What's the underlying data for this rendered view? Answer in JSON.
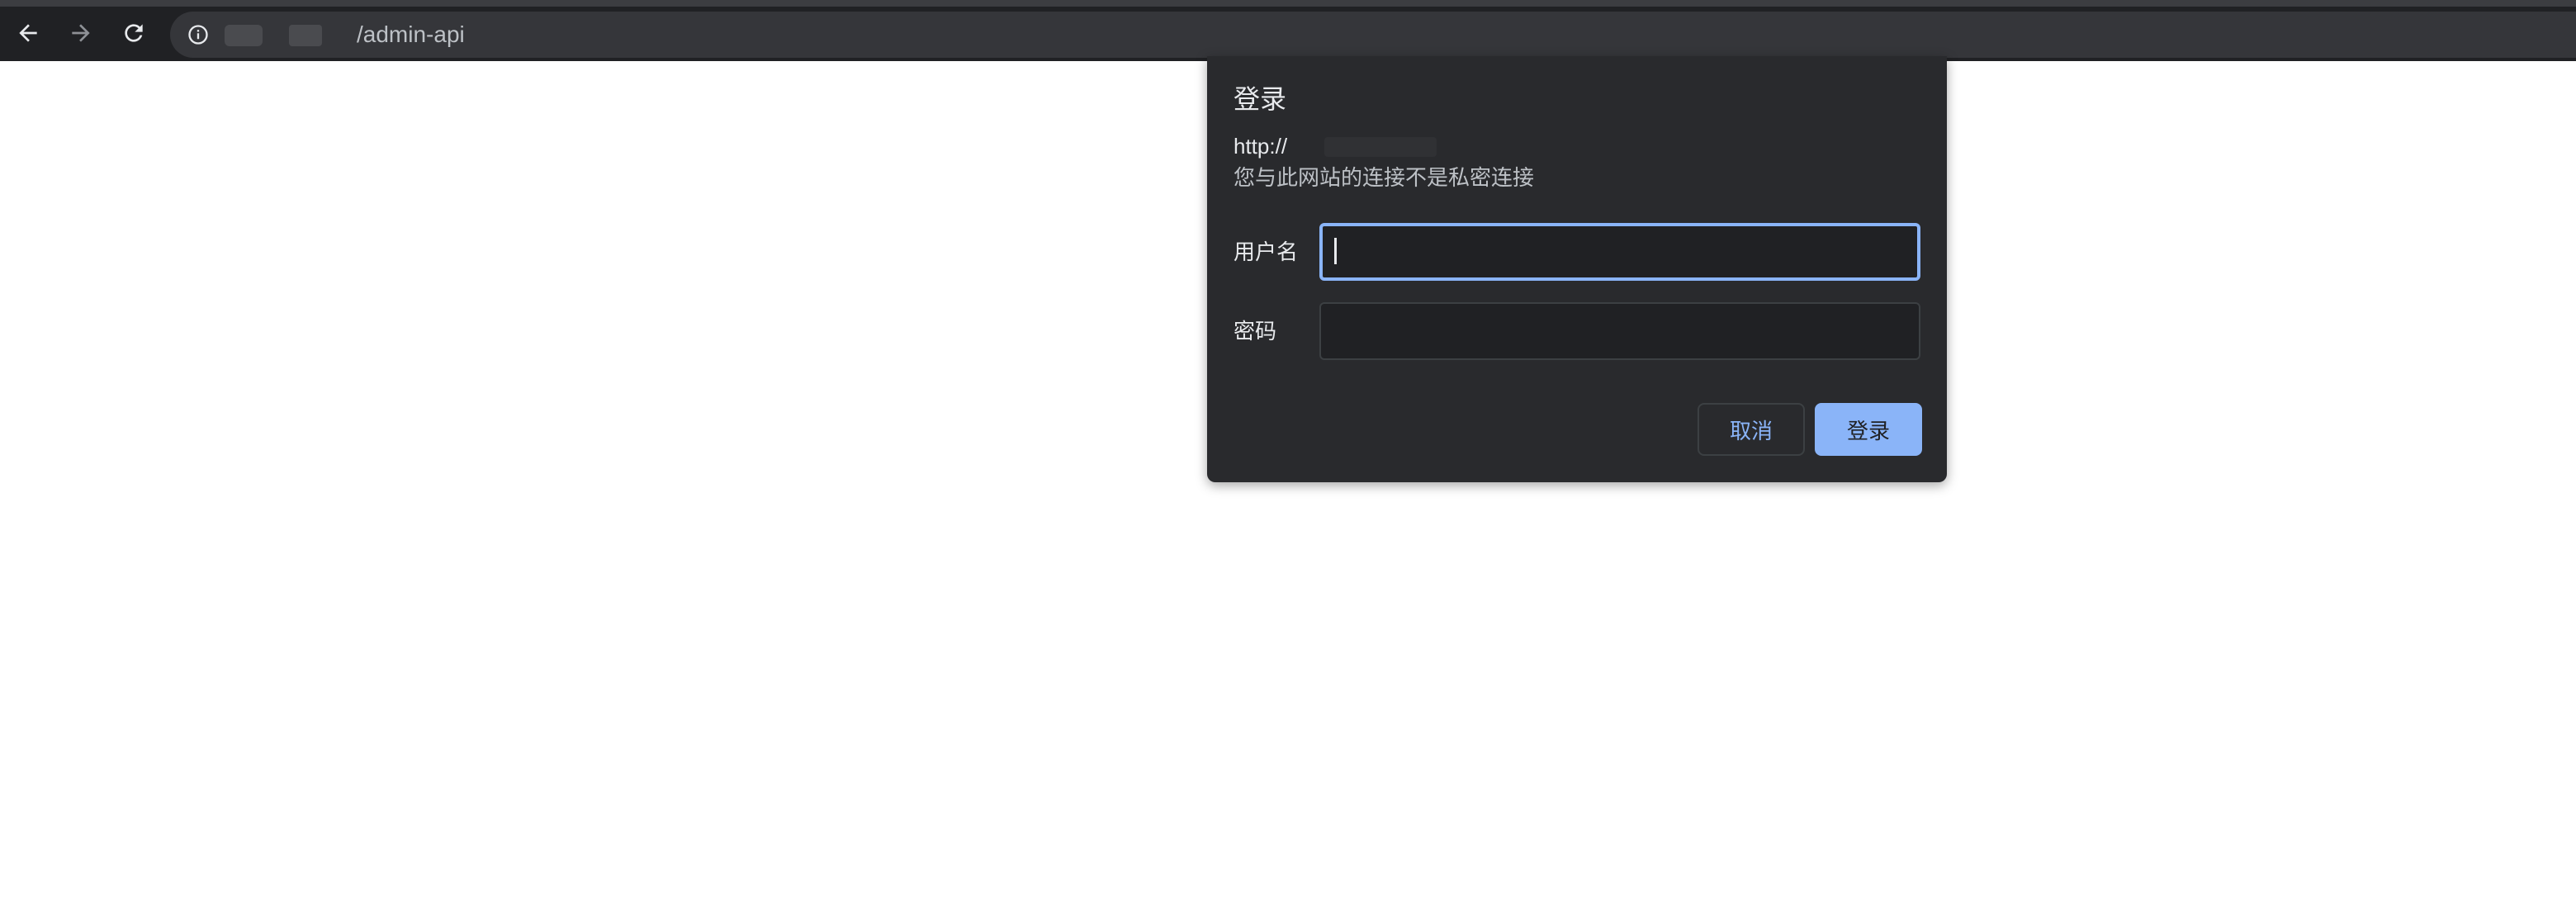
{
  "browser": {
    "toolbar": {
      "back_icon": "arrow-left-icon",
      "forward_icon": "arrow-right-icon",
      "reload_icon": "reload-icon"
    },
    "omnibox": {
      "security_icon": "info-icon",
      "url_suffix": "/admin-api"
    }
  },
  "dialog": {
    "title": "登录",
    "origin": "http://",
    "warning": "您与此网站的连接不是私密连接",
    "fields": {
      "username_label": "用户名",
      "username_value": "",
      "password_label": "密码",
      "password_value": ""
    },
    "buttons": {
      "cancel": "取消",
      "login": "登录"
    }
  },
  "colors": {
    "toolbar_bg": "#202124",
    "dialog_bg": "#292a2d",
    "accent": "#8ab4f8",
    "text_primary": "#e8eaed",
    "text_secondary": "#bdc1c6"
  }
}
